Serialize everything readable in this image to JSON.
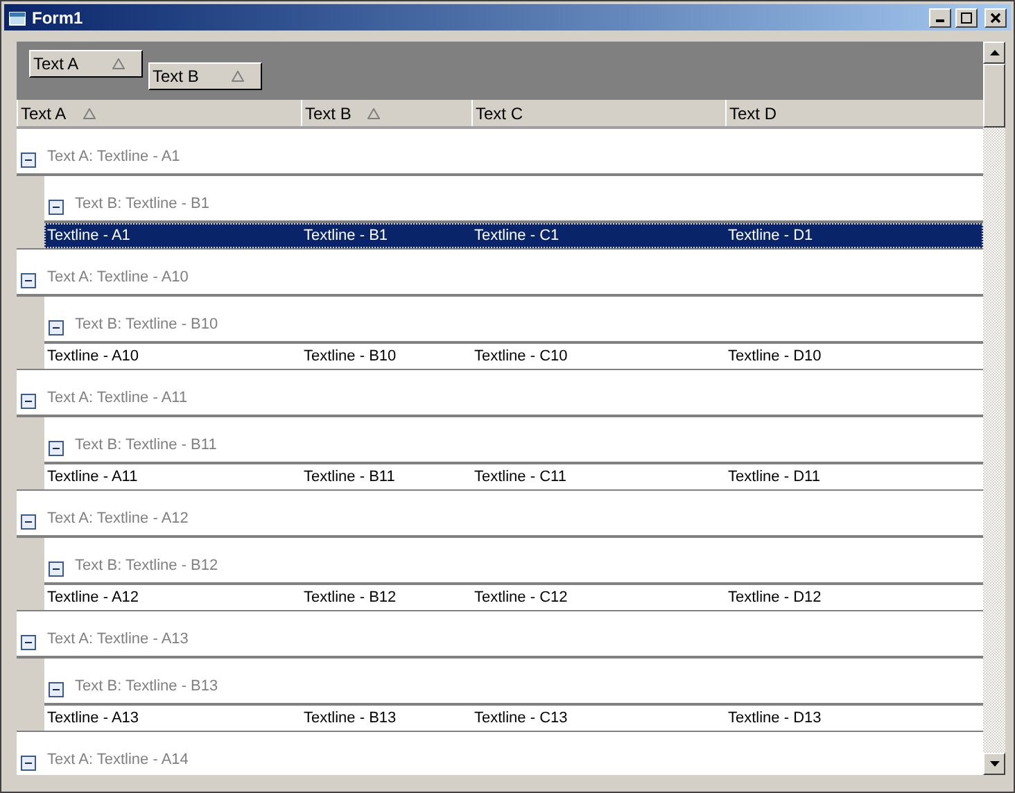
{
  "window": {
    "title": "Form1"
  },
  "group_by": [
    {
      "label": "Text A"
    },
    {
      "label": "Text B"
    }
  ],
  "columns": [
    {
      "label": "Text A",
      "sort_arrow": true
    },
    {
      "label": "Text B",
      "sort_arrow": true
    },
    {
      "label": "Text C",
      "sort_arrow": false
    },
    {
      "label": "Text D",
      "sort_arrow": false
    }
  ],
  "groups": [
    {
      "caption": "Text A: Textline - A1",
      "expanded": true,
      "children": [
        {
          "caption": "Text B: Textline - B1",
          "expanded": true,
          "rows": [
            {
              "cells": [
                "Textline - A1",
                "Textline - B1",
                "Textline - C1",
                "Textline - D1"
              ],
              "selected": true
            }
          ]
        }
      ]
    },
    {
      "caption": "Text A: Textline - A10",
      "expanded": true,
      "children": [
        {
          "caption": "Text B: Textline - B10",
          "expanded": true,
          "rows": [
            {
              "cells": [
                "Textline - A10",
                "Textline - B10",
                "Textline - C10",
                "Textline - D10"
              ],
              "selected": false
            }
          ]
        }
      ]
    },
    {
      "caption": "Text A: Textline - A11",
      "expanded": true,
      "children": [
        {
          "caption": "Text B: Textline - B11",
          "expanded": true,
          "rows": [
            {
              "cells": [
                "Textline - A11",
                "Textline - B11",
                "Textline - C11",
                "Textline - D11"
              ],
              "selected": false
            }
          ]
        }
      ]
    },
    {
      "caption": "Text A: Textline - A12",
      "expanded": true,
      "children": [
        {
          "caption": "Text B: Textline - B12",
          "expanded": true,
          "rows": [
            {
              "cells": [
                "Textline - A12",
                "Textline - B12",
                "Textline - C12",
                "Textline - D12"
              ],
              "selected": false
            }
          ]
        }
      ]
    },
    {
      "caption": "Text A: Textline - A13",
      "expanded": true,
      "children": [
        {
          "caption": "Text B: Textline - B13",
          "expanded": true,
          "rows": [
            {
              "cells": [
                "Textline - A13",
                "Textline - B13",
                "Textline - C13",
                "Textline - D13"
              ],
              "selected": false
            }
          ]
        }
      ]
    },
    {
      "caption": "Text A: Textline - A14",
      "expanded": true
    }
  ]
}
